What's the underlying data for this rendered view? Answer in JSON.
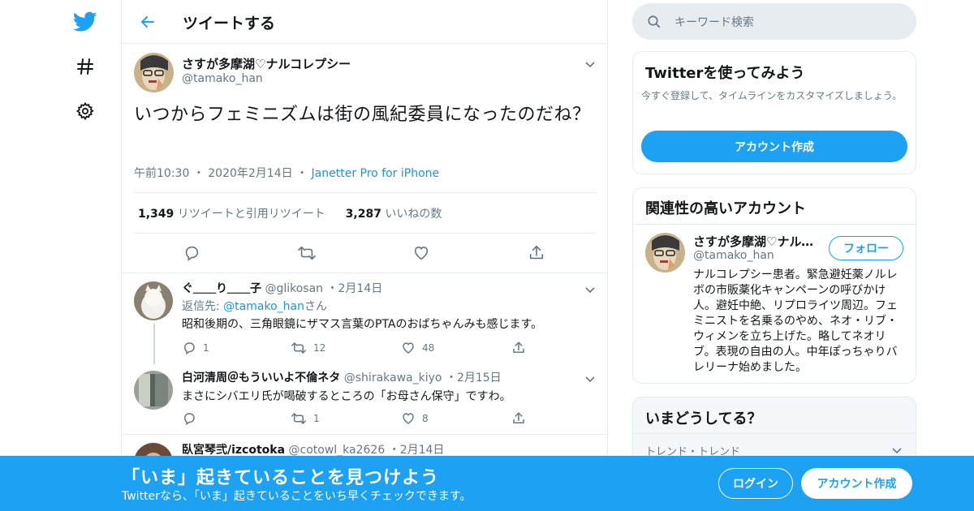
{
  "header": {
    "title": "ツイートする"
  },
  "main_tweet": {
    "name": "さすが多摩湖♡ナルコレプシー",
    "handle": "@tamako_han",
    "text": "いつからフェミニズムは街の風紀委員になったのだね？",
    "time": "午前10:30",
    "date": "2020年2月14日",
    "source": "Janetter Pro for iPhone",
    "retweets": "1,349",
    "retweets_label": "リツイートと引用リツイート",
    "likes": "3,287",
    "likes_label": "いいねの数"
  },
  "replies": [
    {
      "name": "ぐ＿＿り＿＿子",
      "handle": "@glikosan",
      "date": "2月14日",
      "reply_prefix": "返信先: ",
      "reply_to": "@tamako_han",
      "reply_suffix": "さん",
      "text": "昭和後期の、三角眼鏡にザマス言葉のPTAのおばちゃんみも感じます。",
      "reply_count": "1",
      "retweet_count": "12",
      "like_count": "48"
    },
    {
      "name": "白河清周＠もういいよ不倫ネタ",
      "handle": "@shirakawa_kiyo",
      "date": "2月15日",
      "text": "まさにシバエリ氏が喝破するところの「お母さん保守」ですわ。",
      "reply_count": "",
      "retweet_count": "1",
      "like_count": "8"
    },
    {
      "name": "臥宮琴弐/izcotoka",
      "handle": "@cotowl_ka2626",
      "date": "2月14日"
    }
  ],
  "search": {
    "placeholder": "キーワード検索"
  },
  "signup_card": {
    "title": "Twitterを使ってみよう",
    "desc": "今すぐ登録して、タイムラインをカスタマイズしましょう。",
    "button": "アカウント作成"
  },
  "related": {
    "title": "関連性の高いアカウント",
    "name": "さすが多摩湖♡ナルコレプシー",
    "handle": "@tamako_han",
    "follow": "フォロー",
    "bio": "ナルコレプシー患者。緊急避妊薬ノルレボの市販薬化キャンペーンの呼びかけ人。避妊中絶、リプロライツ周辺。フェミニストを名乗るのやめ、ネオ・リブ・ウィメンを立ち上げた。略してネオリブ。表現の自由の人。中年ぽっちゃりバレリーナ始めました。"
  },
  "trends": {
    "title": "いまどうしてる？",
    "label": "トレンド・トレンド"
  },
  "banner": {
    "title": "「いま」起きていることを見つけよう",
    "subtitle": "Twitterなら、「いま」起きていることをいち早くチェックできます。",
    "login": "ログイン",
    "signup": "アカウント作成"
  },
  "colors": {
    "accent": "#1da1f2",
    "link": "#1b95e0",
    "muted": "#657786",
    "border": "#e6ecf0"
  }
}
